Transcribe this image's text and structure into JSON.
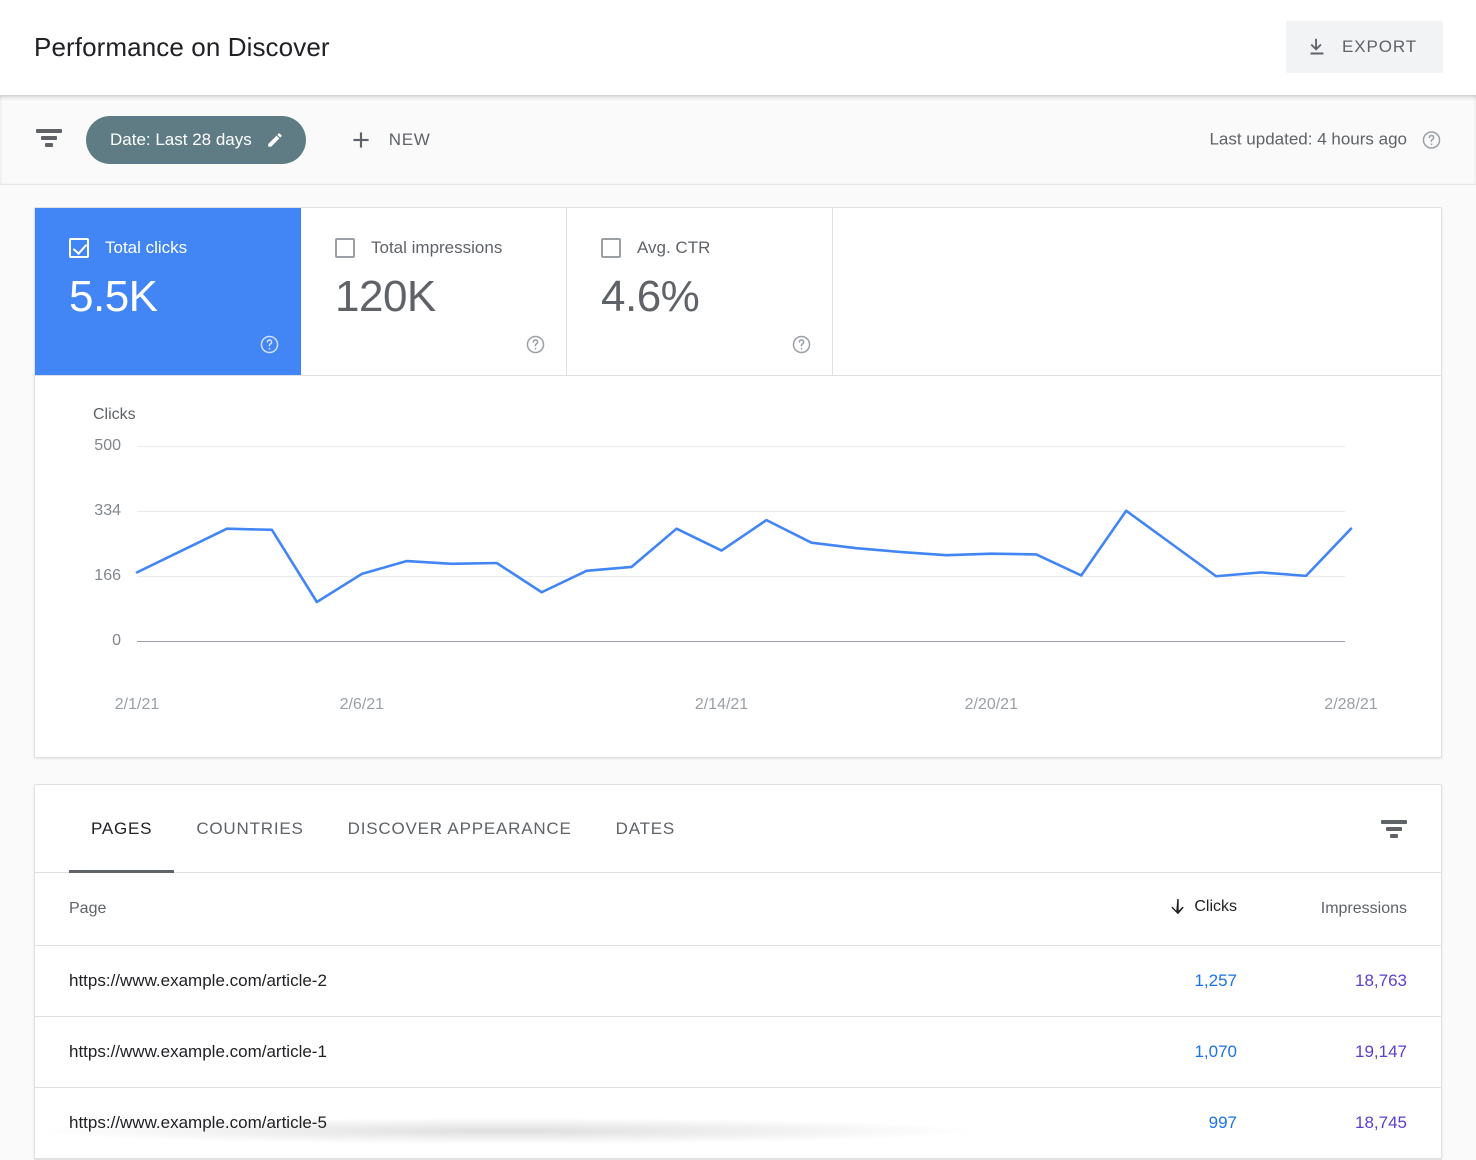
{
  "header": {
    "title": "Performance on Discover",
    "export_label": "EXPORT",
    "export_icon": "download-icon"
  },
  "toolbar": {
    "filter_icon": "filter-icon",
    "date_chip": {
      "label": "Date: Last 28 days",
      "edit_icon": "pencil-icon"
    },
    "new_button": {
      "label": "NEW",
      "icon": "plus-icon"
    },
    "last_updated": "Last updated: 4 hours ago",
    "help_icon": "help-circle-icon"
  },
  "metrics": [
    {
      "label": "Total clicks",
      "value": "5.5K",
      "checked": true,
      "accent": "#4285f4"
    },
    {
      "label": "Total impressions",
      "value": "120K",
      "checked": false
    },
    {
      "label": "Avg. CTR",
      "value": "4.6%",
      "checked": false
    }
  ],
  "chart_data": {
    "type": "line",
    "title": "",
    "metric_name": "Clicks",
    "xlabel": "",
    "ylabel": "Clicks",
    "ylim": [
      0,
      500
    ],
    "yticks": [
      0,
      166,
      334,
      500
    ],
    "ytick_labels": [
      "0",
      "166",
      "334",
      "500"
    ],
    "grid": true,
    "legend": "none",
    "line_color": "#4285f4",
    "x_tick_labels": [
      "2/1/21",
      "2/6/21",
      "2/14/21",
      "2/20/21",
      "2/28/21"
    ],
    "x_tick_indices": [
      0,
      5,
      13,
      19,
      27
    ],
    "x": [
      "2/1/21",
      "2/2/21",
      "2/3/21",
      "2/4/21",
      "2/5/21",
      "2/6/21",
      "2/7/21",
      "2/8/21",
      "2/9/21",
      "2/10/21",
      "2/11/21",
      "2/12/21",
      "2/13/21",
      "2/14/21",
      "2/15/21",
      "2/16/21",
      "2/17/21",
      "2/18/21",
      "2/19/21",
      "2/20/21",
      "2/21/21",
      "2/22/21",
      "2/23/21",
      "2/24/21",
      "2/25/21",
      "2/26/21",
      "2/27/21",
      "2/28/21"
    ],
    "series": [
      {
        "name": "Clicks",
        "values": [
          176,
          232,
          288,
          285,
          100,
          172,
          205,
          198,
          200,
          125,
          180,
          190,
          288,
          232,
          310,
          252,
          238,
          228,
          220,
          224,
          222,
          168,
          334,
          250,
          166,
          176,
          167,
          288
        ]
      }
    ]
  },
  "table_panel": {
    "tabs": [
      {
        "label": "PAGES",
        "active": true
      },
      {
        "label": "COUNTRIES",
        "active": false
      },
      {
        "label": "DISCOVER APPEARANCE",
        "active": false
      },
      {
        "label": "DATES",
        "active": false
      }
    ],
    "filter_icon": "filter-icon",
    "columns": [
      {
        "key": "page",
        "label": "Page",
        "align": "left"
      },
      {
        "key": "clicks",
        "label": "Clicks",
        "align": "right",
        "sorted": true,
        "sort_icon": "arrow-down-icon"
      },
      {
        "key": "impressions",
        "label": "Impressions",
        "align": "right"
      }
    ],
    "rows": [
      {
        "page": "https://www.example.com/article-2",
        "clicks": "1,257",
        "impressions": "18,763"
      },
      {
        "page": "https://www.example.com/article-1",
        "clicks": "1,070",
        "impressions": "19,147"
      },
      {
        "page": "https://www.example.com/article-5",
        "clicks": "997",
        "impressions": "18,745"
      }
    ]
  }
}
